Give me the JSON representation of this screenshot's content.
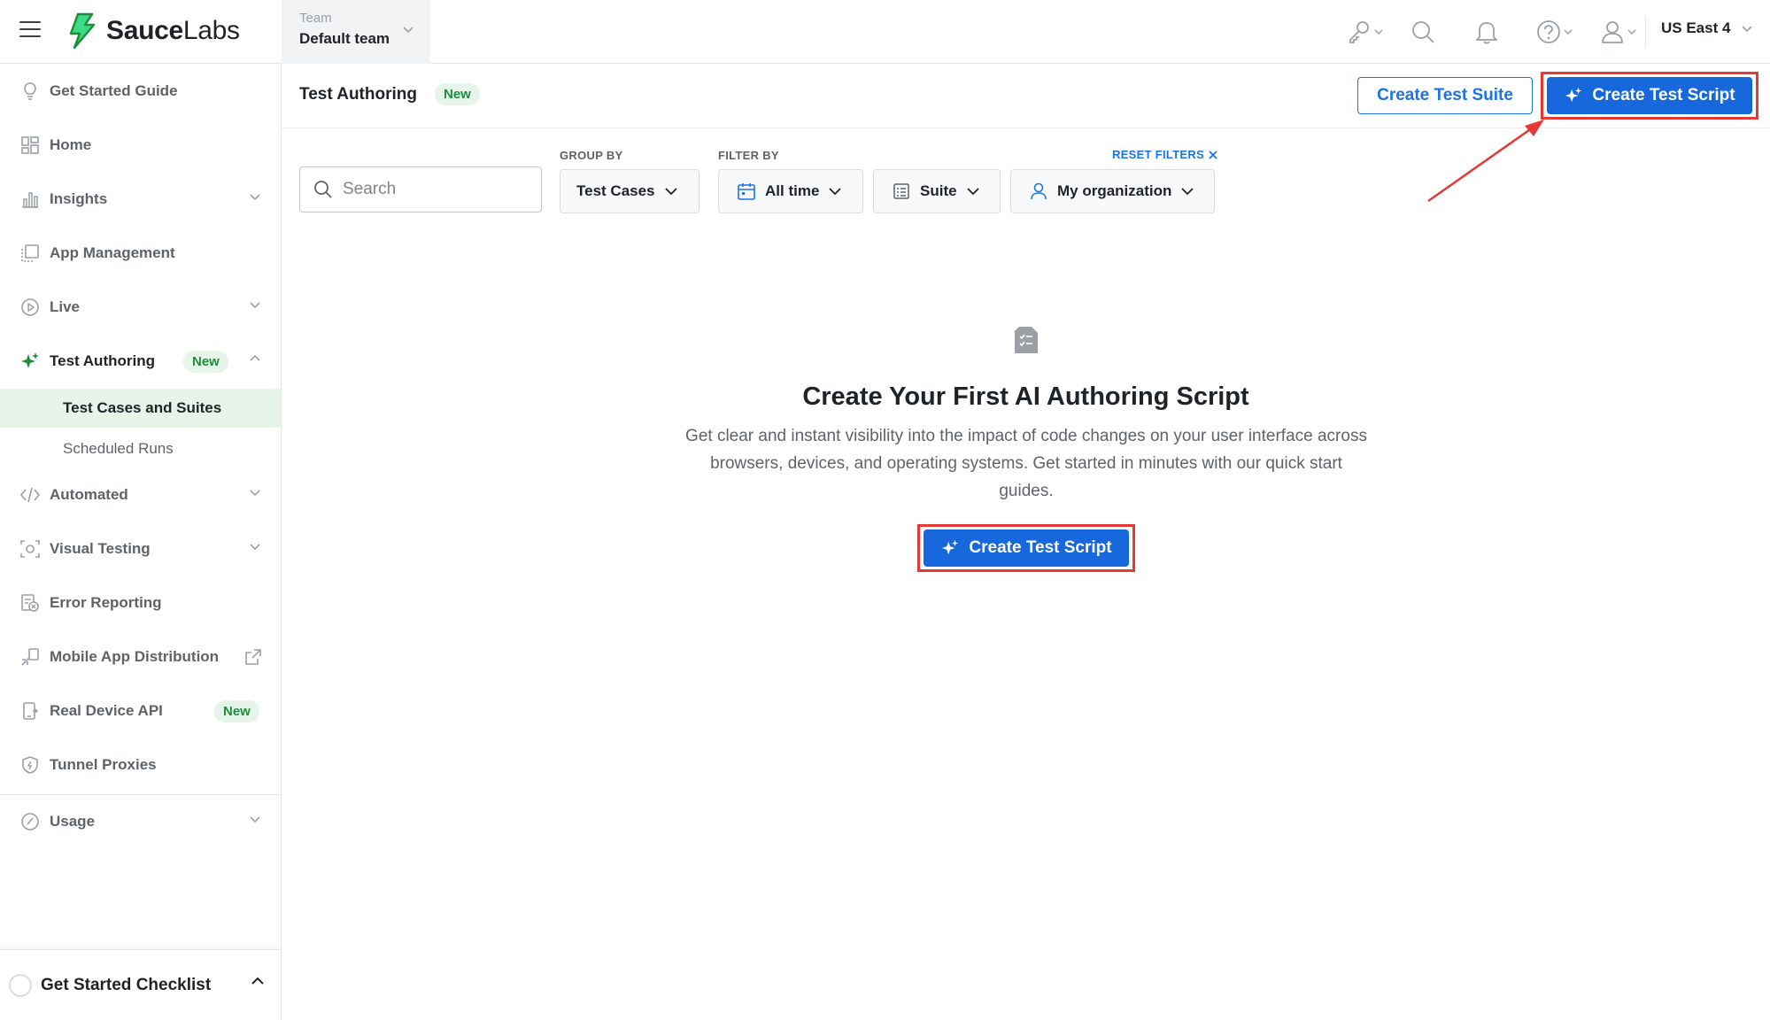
{
  "header": {
    "logo_bold": "Sauce",
    "logo_light": "Labs",
    "team_label": "Team",
    "team_value": "Default team",
    "region": "US East 4"
  },
  "sidebar": {
    "items": [
      {
        "label": "Get Started Guide",
        "icon": "lightbulb-icon"
      },
      {
        "label": "Home",
        "icon": "grid-icon"
      },
      {
        "label": "Insights",
        "icon": "bar-chart-icon"
      },
      {
        "label": "App Management",
        "icon": "app-management-icon"
      },
      {
        "label": "Live",
        "icon": "play-circle-icon"
      },
      {
        "label": "Test Authoring",
        "icon": "sparkle-icon",
        "badge": "New"
      },
      {
        "label": "Automated",
        "icon": "code-icon"
      },
      {
        "label": "Visual Testing",
        "icon": "eye-icon"
      },
      {
        "label": "Error Reporting",
        "icon": "bug-icon"
      },
      {
        "label": "Mobile App Distribution",
        "icon": "distribution-icon"
      },
      {
        "label": "Real Device API",
        "icon": "device-icon",
        "badge": "New"
      },
      {
        "label": "Tunnel Proxies",
        "icon": "shield-icon"
      },
      {
        "label": "Usage",
        "icon": "gauge-icon"
      }
    ],
    "subitems": [
      {
        "label": "Test Cases and Suites"
      },
      {
        "label": "Scheduled Runs"
      }
    ],
    "checklist": "Get Started Checklist"
  },
  "page": {
    "title": "Test Authoring",
    "badge": "New",
    "create_suite": "Create Test Suite",
    "create_script": "Create Test Script"
  },
  "filters": {
    "search_placeholder": "Search",
    "group_by_label": "GROUP BY",
    "filter_by_label": "FILTER BY",
    "reset_label": "RESET FILTERS",
    "group_by_value": "Test Cases",
    "time_value": "All time",
    "suite_value": "Suite",
    "org_value": "My organization"
  },
  "empty_state": {
    "title": "Create Your First AI Authoring Script",
    "description": "Get clear and instant visibility into the impact of code changes on your user interface across browsers, devices, and operating systems. Get started in minutes with our quick start guides.",
    "button": "Create Test Script"
  },
  "colors": {
    "accent": "#1668dc",
    "brand_green": "#3ddc84",
    "highlight": "#e53935",
    "badge_bg": "#e6f4ea"
  }
}
